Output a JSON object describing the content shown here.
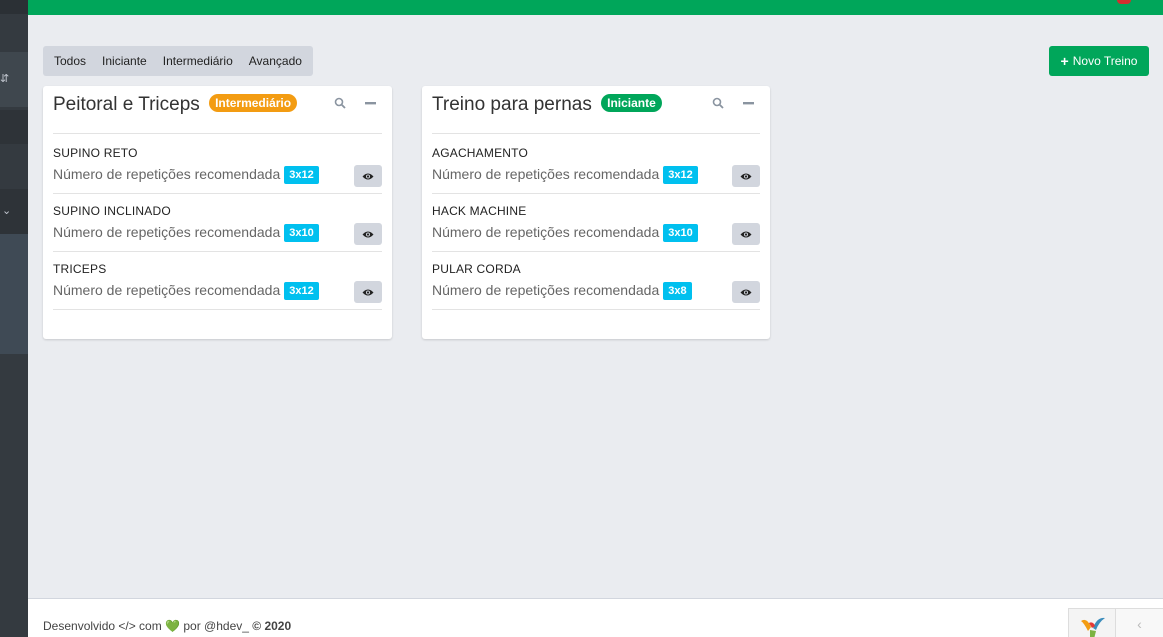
{
  "filters": [
    "Todos",
    "Iniciante",
    "Intermediário",
    "Avançado"
  ],
  "new_button": {
    "plus": "+",
    "label": "Novo Treino"
  },
  "colors": {
    "primary_green": "#00a65a",
    "warning_orange": "#f39c12",
    "info_cyan": "#00c0ef",
    "sidebar": "#343a40"
  },
  "cards": [
    {
      "title": "Peitoral e Triceps",
      "level": "Intermediário",
      "exercises": [
        {
          "name": "SUPINO RETO",
          "desc": "Número de repetições recomendada",
          "reps": "3x12"
        },
        {
          "name": "SUPINO INCLINADO",
          "desc": "Número de repetições recomendada",
          "reps": "3x10"
        },
        {
          "name": "TRICEPS",
          "desc": "Número de repetições recomendada",
          "reps": "3x12"
        }
      ]
    },
    {
      "title": "Treino para pernas",
      "level": "Iniciante",
      "exercises": [
        {
          "name": "AGACHAMENTO",
          "desc": "Número de repetições recomendada",
          "reps": "3x12"
        },
        {
          "name": "HACK MACHINE",
          "desc": "Número de repetições recomendada",
          "reps": "3x10"
        },
        {
          "name": "PULAR CORDA",
          "desc": "Número de repetições recomendada",
          "reps": "3x8"
        }
      ]
    }
  ],
  "footer": {
    "prefix": "Desenvolvido </> com",
    "heart": "💚",
    "by": "por @hdev_",
    "copyright": "© 2020"
  }
}
